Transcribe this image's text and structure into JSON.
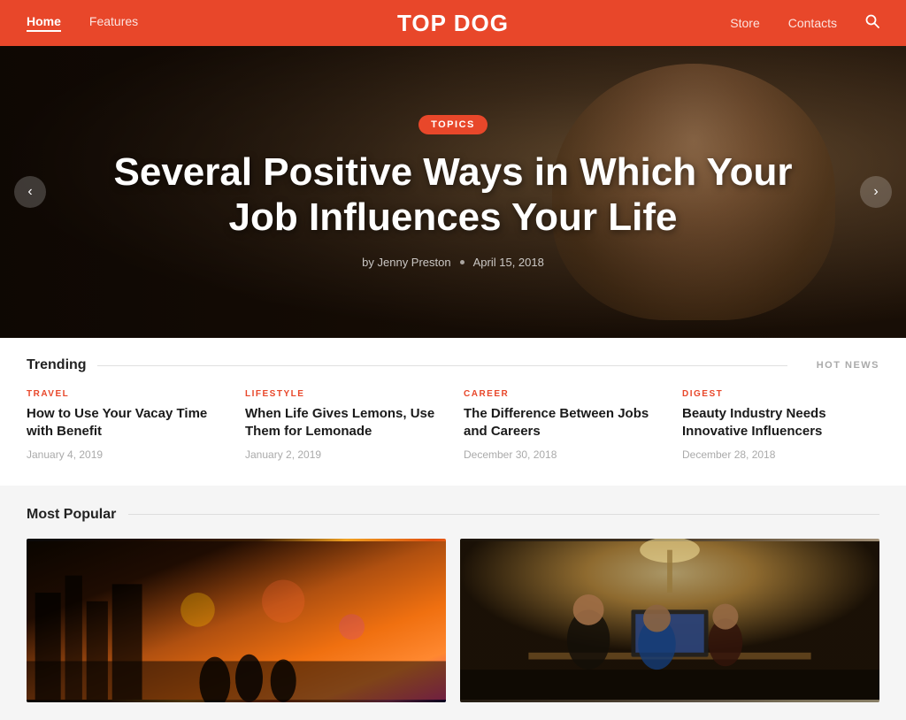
{
  "header": {
    "logo": "TOP DOG",
    "nav": [
      {
        "label": "Home",
        "active": true
      },
      {
        "label": "Features",
        "active": false
      },
      {
        "label": "Store",
        "active": false
      },
      {
        "label": "Contacts",
        "active": false
      }
    ],
    "search_icon": "🔍"
  },
  "hero": {
    "badge": "TOPICS",
    "title": "Several Positive Ways in Which Your Job Influences Your Life",
    "author": "by Jenny Preston",
    "date": "April 15, 2018",
    "prev_label": "‹",
    "next_label": "›"
  },
  "trending": {
    "title": "Trending",
    "hot_news_label": "HOT NEWS",
    "cards": [
      {
        "category": "TRAVEL",
        "title": "How to Use Your Vacay Time with Benefit",
        "date": "January 4, 2019"
      },
      {
        "category": "LIFESTYLE",
        "title": "When Life Gives Lemons, Use Them for Lemonade",
        "date": "January 2, 2019"
      },
      {
        "category": "CAREER",
        "title": "The Difference Between Jobs and Careers",
        "date": "December 30, 2018"
      },
      {
        "category": "DIGEST",
        "title": "Beauty Industry Needs Innovative Influencers",
        "date": "December 28, 2018"
      }
    ]
  },
  "most_popular": {
    "title": "Most Popular",
    "cards": [
      {
        "alt": "City night street scene"
      },
      {
        "alt": "Office team working"
      }
    ]
  }
}
